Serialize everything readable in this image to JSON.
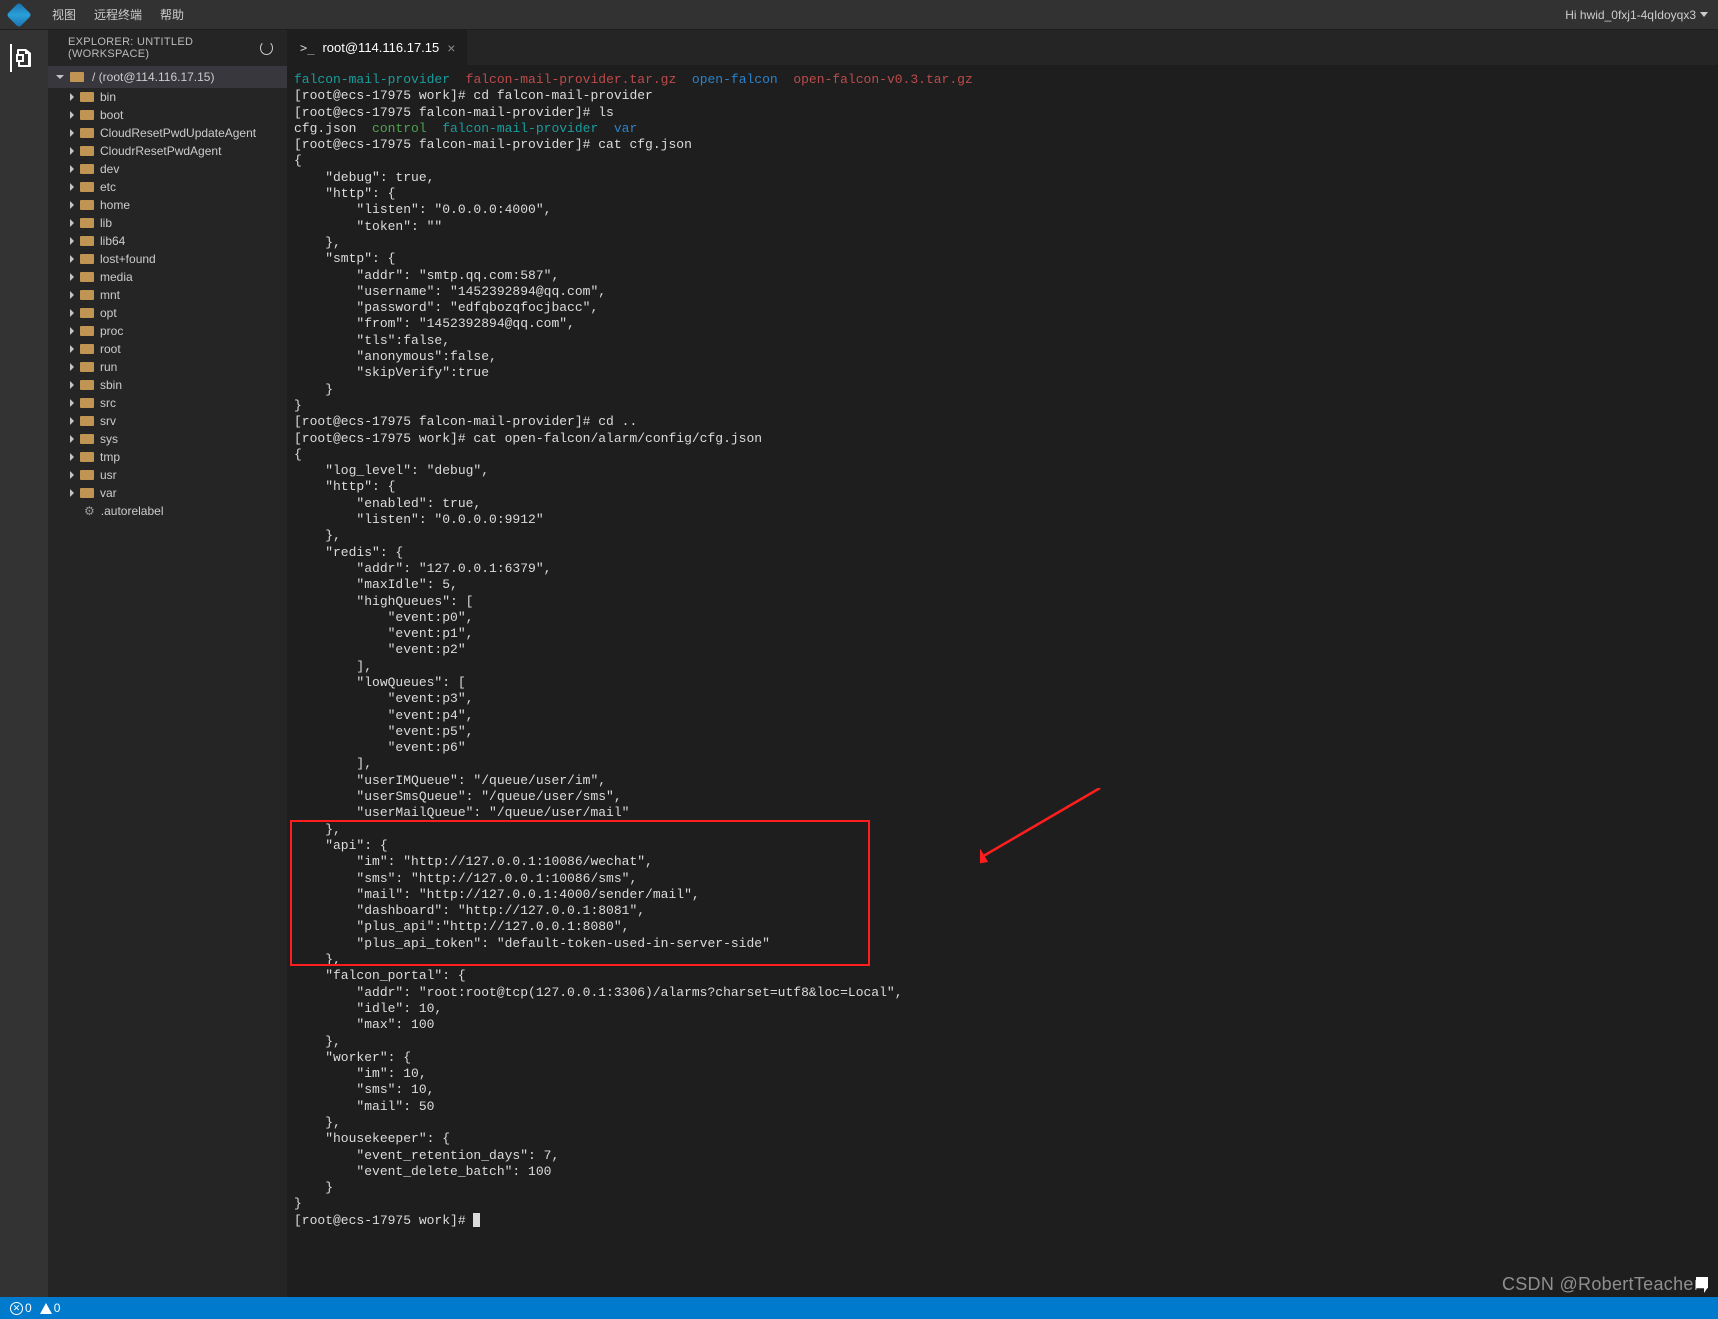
{
  "topbar": {
    "menu": [
      "视图",
      "远程终端",
      "帮助"
    ],
    "user_greeting": "Hi hwid_0fxj1-4qIdoyqx3"
  },
  "explorer": {
    "header": "EXPLORER: UNTITLED (WORKSPACE)",
    "root_label": "/ (root@114.116.17.15)",
    "items": [
      "bin",
      "boot",
      "CloudResetPwdUpdateAgent",
      "CloudrResetPwdAgent",
      "dev",
      "etc",
      "home",
      "lib",
      "lib64",
      "lost+found",
      "media",
      "mnt",
      "opt",
      "proc",
      "root",
      "run",
      "sbin",
      "src",
      "srv",
      "sys",
      "tmp",
      "usr",
      "var"
    ],
    "dotfile": ".autorelabel"
  },
  "tab": {
    "title": "root@114.116.17.15"
  },
  "terminal": {
    "row1": {
      "a": "falcon-mail-provider",
      "b": "falcon-mail-provider.tar.gz",
      "c": "open-falcon",
      "d": "open-falcon-v0.3.tar.gz"
    },
    "prompt_work": "[root@ecs-17975 work]# ",
    "prompt_fmp": "[root@ecs-17975 falcon-mail-provider]# ",
    "cmd_cd_fmp": "cd falcon-mail-provider",
    "cmd_ls": "ls",
    "ls_out": {
      "a": "cfg.json",
      "b": "control",
      "c": "falcon-mail-provider",
      "d": "var"
    },
    "cmd_cat_cfg": "cat cfg.json",
    "cfg_json": "{\n    \"debug\": true,\n    \"http\": {\n        \"listen\": \"0.0.0.0:4000\",\n        \"token\": \"\"\n    },\n    \"smtp\": {\n        \"addr\": \"smtp.qq.com:587\",\n        \"username\": \"1452392894@qq.com\",\n        \"password\": \"edfqbozqfocjbacc\",\n        \"from\": \"1452392894@qq.com\",\n        \"tls\":false,\n        \"anonymous\":false,\n        \"skipVerify\":true\n    }\n}",
    "cmd_cd_up": "cd ..",
    "cmd_cat_alarm": "cat open-falcon/alarm/config/cfg.json",
    "alarm_pre": "{\n    \"log_level\": \"debug\",\n    \"http\": {\n        \"enabled\": true,\n        \"listen\": \"0.0.0.0:9912\"\n    },\n    \"redis\": {\n        \"addr\": \"127.0.0.1:6379\",\n        \"maxIdle\": 5,\n        \"highQueues\": [\n            \"event:p0\",\n            \"event:p1\",\n            \"event:p2\"\n        ],\n        \"lowQueues\": [\n            \"event:p3\",\n            \"event:p4\",\n            \"event:p5\",\n            \"event:p6\"\n        ],\n        \"userIMQueue\": \"/queue/user/im\",\n        \"userSmsQueue\": \"/queue/user/sms\",\n        \"userMailQueue\": \"/queue/user/mail\"",
    "alarm_api": "    },\n    \"api\": {\n        \"im\": \"http://127.0.0.1:10086/wechat\",\n        \"sms\": \"http://127.0.0.1:10086/sms\",\n        \"mail\": \"http://127.0.0.1:4000/sender/mail\",\n        \"dashboard\": \"http://127.0.0.1:8081\",\n        \"plus_api\":\"http://127.0.0.1:8080\",\n        \"plus_api_token\": \"default-token-used-in-server-side\"\n    },",
    "alarm_post": "    \"falcon_portal\": {\n        \"addr\": \"root:root@tcp(127.0.0.1:3306)/alarms?charset=utf8&loc=Local\",\n        \"idle\": 10,\n        \"max\": 100\n    },\n    \"worker\": {\n        \"im\": 10,\n        \"sms\": 10,\n        \"mail\": 50\n    },\n    \"housekeeper\": {\n        \"event_retention_days\": 7,\n        \"event_delete_batch\": 100\n    }\n}",
    "final_prompt": "[root@ecs-17975 work]# "
  },
  "statusbar": {
    "errors": "0",
    "warnings": "0"
  },
  "watermark": "CSDN @RobertTeacher"
}
